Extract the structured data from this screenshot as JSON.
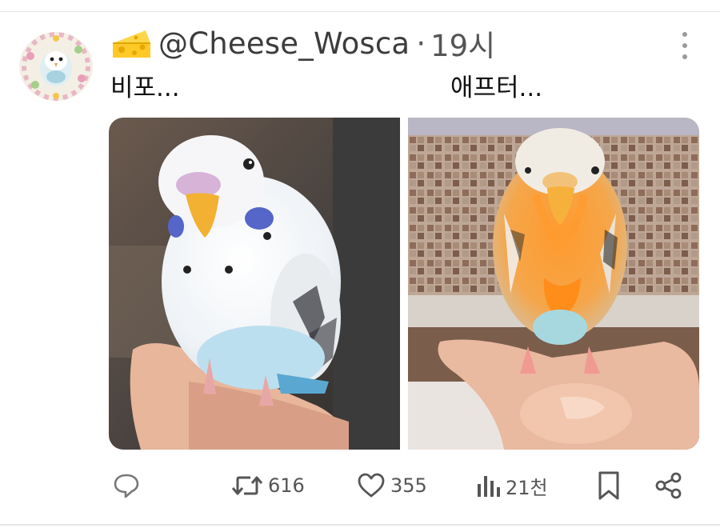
{
  "post": {
    "handle": "@Cheese_Wosca",
    "separator": "·",
    "time": "19시",
    "caption_before": "비포...",
    "caption_after": "애프터..."
  },
  "actions": {
    "retweets": "616",
    "likes": "355",
    "views": "21천"
  },
  "icons": {
    "avatar": "budgie-illustration-avatar",
    "emoji": "cheese-emoji",
    "more": "more-dots-icon",
    "reply": "reply-icon",
    "retweet": "retweet-icon",
    "like": "heart-icon",
    "views": "views-icon",
    "bookmark": "bookmark-icon",
    "share": "share-icon"
  },
  "colors": {
    "icon_gray": "#555555",
    "divider": "#e6e6e6"
  }
}
